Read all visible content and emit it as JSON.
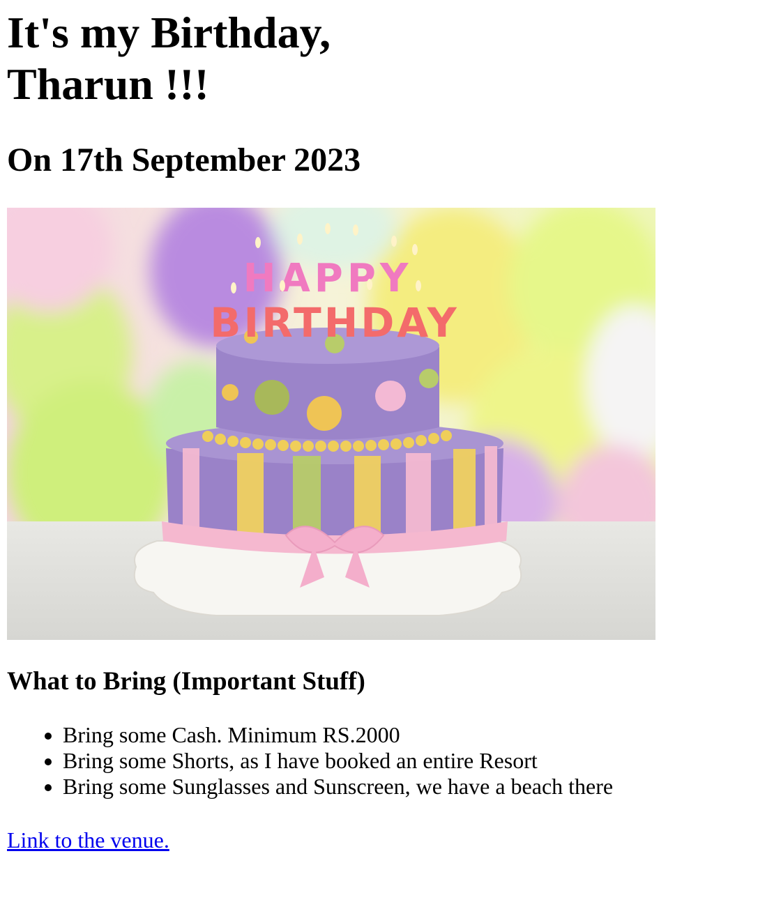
{
  "header": {
    "title": "It's my Birthday, Tharun !!!",
    "date": "On 17th September 2023"
  },
  "image": {
    "icon": "birthday-cake-photo",
    "candle_text_top": "HAPPY",
    "candle_text_bottom": "BIRTHDAY"
  },
  "bring": {
    "heading": "What to Bring (Important Stuff)",
    "items": [
      "Bring some Cash. Minimum RS.2000",
      "Bring some Shorts, as I have booked an entire Resort",
      "Bring some Sunglasses and Sunscreen, we have a beach there"
    ]
  },
  "link": {
    "label": "Link to the venue."
  },
  "colors": {
    "link": "#0000ee",
    "cake_purple": "#9b84c9",
    "cake_pink": "#f5b8cf",
    "cake_yellow": "#f0d060",
    "cake_green": "#b8cc6a"
  }
}
